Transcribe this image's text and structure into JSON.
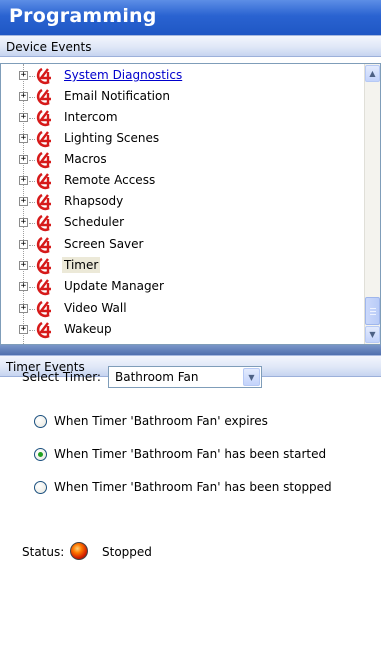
{
  "window": {
    "title": "Programming"
  },
  "device_events": {
    "header": "Device Events",
    "items": [
      {
        "label": "System Diagnostics",
        "state": "link"
      },
      {
        "label": "Email Notification",
        "state": "normal"
      },
      {
        "label": "Intercom",
        "state": "normal"
      },
      {
        "label": "Lighting Scenes",
        "state": "normal"
      },
      {
        "label": "Macros",
        "state": "normal"
      },
      {
        "label": "Remote Access",
        "state": "normal"
      },
      {
        "label": "Rhapsody",
        "state": "normal"
      },
      {
        "label": "Scheduler",
        "state": "normal"
      },
      {
        "label": "Screen Saver",
        "state": "normal"
      },
      {
        "label": "Timer",
        "state": "selected"
      },
      {
        "label": "Update Manager",
        "state": "normal"
      },
      {
        "label": "Video Wall",
        "state": "normal"
      },
      {
        "label": "Wakeup",
        "state": "normal"
      }
    ],
    "expander_symbol": "+",
    "icon": "control4-logo-icon"
  },
  "timer_events": {
    "header": "Timer Events",
    "select_label": "Select Timer:",
    "selected_timer": "Bathroom Fan",
    "options": [
      {
        "label": "When Timer 'Bathroom Fan' expires",
        "checked": false
      },
      {
        "label": "When Timer 'Bathroom Fan' has been started",
        "checked": true
      },
      {
        "label": "When Timer 'Bathroom Fan' has been stopped",
        "checked": false
      }
    ],
    "status_label": "Status:",
    "status_value": "Stopped"
  },
  "colors": {
    "title_bar": "#2a63d1",
    "link": "#0000cc",
    "selected_bg": "#ece9d8",
    "c4_red": "#d61a1a"
  }
}
